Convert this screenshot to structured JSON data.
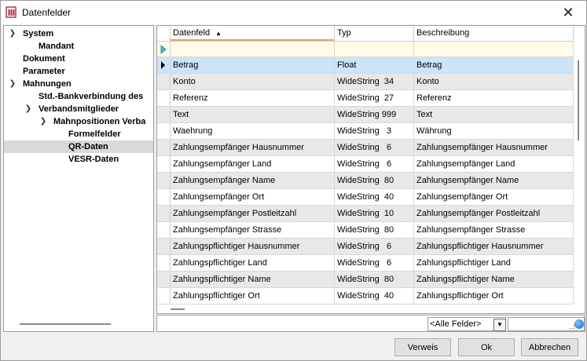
{
  "window": {
    "title": "Datenfelder"
  },
  "tree": {
    "items": [
      {
        "label": "System",
        "expanded": true
      },
      {
        "label": "Mandant"
      },
      {
        "label": "Dokument"
      },
      {
        "label": "Parameter"
      },
      {
        "label": "Mahnungen",
        "expanded": true
      },
      {
        "label": "Std.-Bankverbindung des"
      },
      {
        "label": "Verbandsmitglieder",
        "expanded": true
      },
      {
        "label": "Mahnpositionen Verba",
        "expanded": true
      },
      {
        "label": "Formelfelder"
      },
      {
        "label": "QR-Daten",
        "selected": true
      },
      {
        "label": "VESR-Daten"
      }
    ]
  },
  "grid": {
    "columns": [
      "Datenfeld",
      "Typ",
      "Beschreibung"
    ],
    "rows": [
      [
        "Betrag",
        "Float",
        "Betrag"
      ],
      [
        "Konto",
        "WideString  34",
        "Konto"
      ],
      [
        "Referenz",
        "WideString  27",
        "Referenz"
      ],
      [
        "Text",
        "WideString 999",
        "Text"
      ],
      [
        "Waehrung",
        "WideString   3",
        "Währung"
      ],
      [
        "Zahlungsempfänger Hausnummer",
        "WideString   6",
        "Zahlungsempfänger Hausnummer"
      ],
      [
        "Zahlungsempfänger Land",
        "WideString   6",
        "Zahlungsempfänger Land"
      ],
      [
        "Zahlungsempfänger Name",
        "WideString  80",
        "Zahlungsempfänger Name"
      ],
      [
        "Zahlungsempfänger Ort",
        "WideString  40",
        "Zahlungsempfänger Ort"
      ],
      [
        "Zahlungsempfänger Postleitzahl",
        "WideString  10",
        "Zahlungsempfänger Postleitzahl"
      ],
      [
        "Zahlungsempfänger Strasse",
        "WideString  80",
        "Zahlungsempfänger Strasse"
      ],
      [
        "Zahlungspflichtiger Hausnummer",
        "WideString   6",
        "Zahlungspflichtiger Hausnummer"
      ],
      [
        "Zahlungspflichtiger Land",
        "WideString   6",
        "Zahlungspflichtiger Land"
      ],
      [
        "Zahlungspflichtiger Name",
        "WideString  80",
        "Zahlungspflichtiger Name"
      ],
      [
        "Zahlungspflichtiger Ort",
        "WideString  40",
        "Zahlungspflichtiger Ort"
      ]
    ]
  },
  "filter": {
    "selected": "<Alle Felder>"
  },
  "buttons": {
    "verweis": "Verweis",
    "ok": "Ok",
    "abbrechen": "Abbrechen"
  },
  "colors": {
    "selection": "#cce4f7",
    "tree_selection": "#d9d9d9",
    "new_row": "#fffbe6",
    "sort_accent": "#e8a070"
  }
}
